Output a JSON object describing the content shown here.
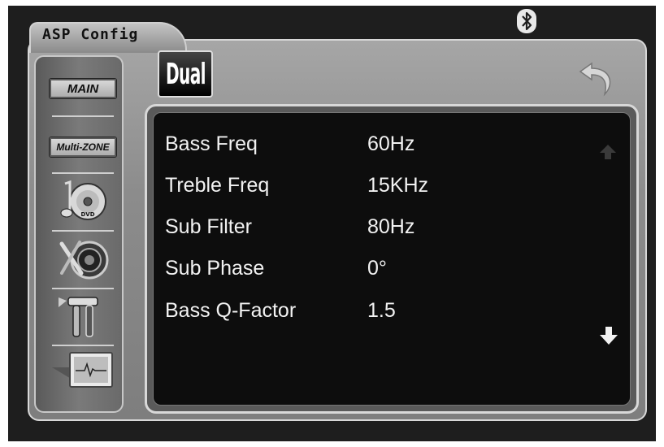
{
  "header": {
    "title": "ASP Config",
    "brand_logo": "Dual",
    "status_icon": "bluetooth-icon",
    "back_icon": "back-arrow-icon"
  },
  "sidebar": {
    "items": [
      {
        "label": "MAIN",
        "type": "button"
      },
      {
        "label": "Multi-ZONE",
        "type": "button"
      },
      {
        "icon": "dvd-music-icon"
      },
      {
        "icon": "speaker-settings-icon"
      },
      {
        "icon": "tools-icon"
      },
      {
        "icon": "asp-monitor-icon"
      }
    ]
  },
  "settings": {
    "rows": [
      {
        "label": "Bass Freq",
        "value": "60Hz"
      },
      {
        "label": "Treble Freq",
        "value": "15KHz"
      },
      {
        "label": "Sub Filter",
        "value": "80Hz"
      },
      {
        "label": "Sub Phase",
        "value": "0°"
      },
      {
        "label": "Bass Q-Factor",
        "value": "1.5"
      }
    ],
    "scroll_up_icon": "arrow-up-icon",
    "scroll_down_icon": "arrow-down-icon"
  },
  "colors": {
    "screen_bg": "#1e1e1e",
    "panel": "#8c8c8c",
    "content_bg": "#0d0d0d",
    "text": "#f2f2f2"
  }
}
